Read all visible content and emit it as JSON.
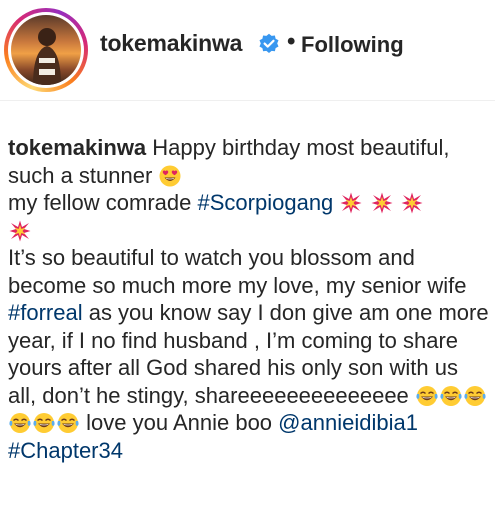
{
  "header": {
    "username": "tokemakinwa",
    "separator": "•",
    "follow_status": "Following"
  },
  "caption": {
    "author": "tokemakinwa",
    "line1": " Happy birthday most beautiful, such a stunner ",
    "line2_text": "my fellow comrade ",
    "hashtag1": "#Scorpiogang",
    "body_text": "It’s so beautiful to watch you blossom and become so much more my love, my senior wife ",
    "hashtag2": "#forreal",
    "body_text2": " as you know say I don give am one more year, if I no find husband , I’m coming to share yours after all God shared his only son with us all, don’t he stingy, shareeeeeeeeeeeeee ",
    "closing_text": " love you Annie boo ",
    "mention": "@annieidibia1",
    "hashtag3": "#Chapter34",
    "emojis": [
      "heart-eyes-emoji",
      "collision-emoji",
      "collision-emoji",
      "collision-emoji",
      "collision-emoji",
      "tears-of-joy-emoji"
    ]
  },
  "colors": {
    "text": "#262626",
    "link": "#00376b",
    "verified": "#3897f0"
  }
}
